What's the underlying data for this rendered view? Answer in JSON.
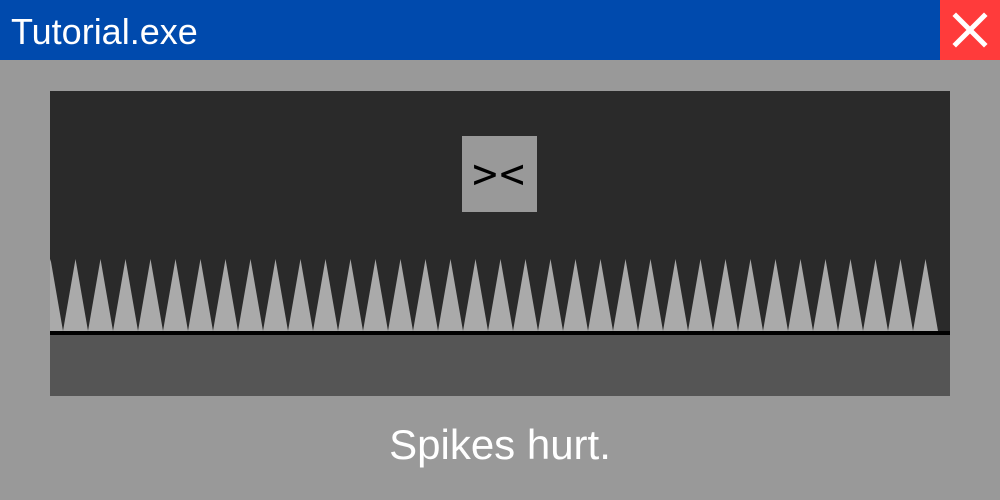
{
  "window": {
    "title": "Tutorial.exe",
    "close_icon": "close-icon"
  },
  "colors": {
    "titlebar": "#004aad",
    "close_button": "#ff3b3b",
    "window_bg": "#999999",
    "game_bg": "#2a2a2a",
    "player": "#999999",
    "spike": "#aaaaaa",
    "ground_line": "#000000",
    "ground": "#555555"
  },
  "game": {
    "player_face": "><",
    "spike_count": 36
  },
  "caption": "Spikes hurt."
}
